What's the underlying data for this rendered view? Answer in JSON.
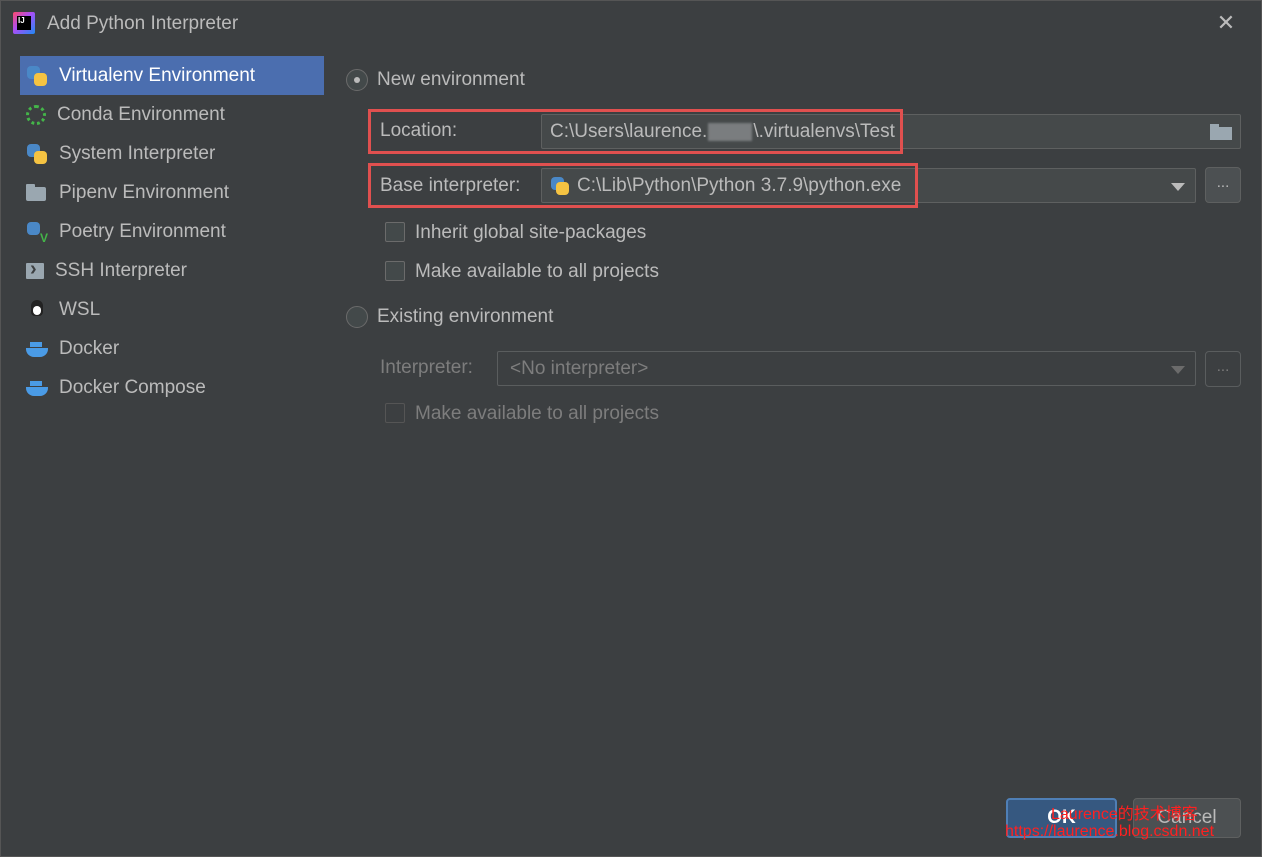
{
  "window": {
    "title": "Add Python Interpreter",
    "app_icon_text": "IJ"
  },
  "sidebar": {
    "items": [
      {
        "label": "Virtualenv Environment",
        "icon": "python-icon",
        "selected": true
      },
      {
        "label": "Conda Environment",
        "icon": "conda-icon"
      },
      {
        "label": "System Interpreter",
        "icon": "python-icon"
      },
      {
        "label": "Pipenv Environment",
        "icon": "pipenv-icon"
      },
      {
        "label": "Poetry Environment",
        "icon": "poetry-icon"
      },
      {
        "label": "SSH Interpreter",
        "icon": "ssh-icon"
      },
      {
        "label": "WSL",
        "icon": "tux-icon"
      },
      {
        "label": "Docker",
        "icon": "docker-icon"
      },
      {
        "label": "Docker Compose",
        "icon": "docker-icon"
      }
    ]
  },
  "new_env": {
    "radio_label": "New environment",
    "selected": true,
    "location_label": "Location:",
    "location_prefix": "C:\\Users\\laurence.",
    "location_suffix": "\\.virtualenvs\\Test",
    "base_label": "Base interpreter:",
    "base_value": "C:\\Lib\\Python\\Python 3.7.9\\python.exe",
    "browse_label": "...",
    "inherit_label": "Inherit global site-packages",
    "make_available_label": "Make available to all projects"
  },
  "existing_env": {
    "radio_label": "Existing environment",
    "selected": false,
    "interpreter_label": "Interpreter:",
    "interpreter_value": "<No interpreter>",
    "browse_label": "...",
    "make_available_label": "Make available to all projects"
  },
  "buttons": {
    "ok": "OK",
    "cancel": "Cancel"
  },
  "watermark": {
    "line1": "Laurence的技术博客",
    "line2": "https://laurence.blog.csdn.net"
  },
  "colors": {
    "background": "#3c3f41",
    "selection": "#4b6eaf",
    "highlight_box": "#e0504f",
    "ok_button": "#365880"
  }
}
